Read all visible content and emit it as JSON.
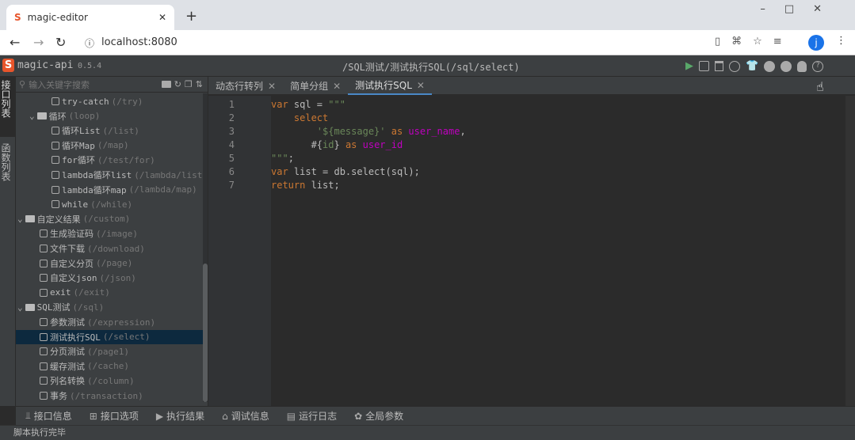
{
  "browser": {
    "tab_title": "magic-editor",
    "url": "localhost:8080",
    "avatar": "j"
  },
  "app": {
    "name": "magic-api",
    "version": "0.5.4",
    "path_title": "/SQL测试/测试执行SQL(/sql/select)"
  },
  "side_tabs": [
    {
      "label": "接口列表"
    },
    {
      "label": "函数列表"
    }
  ],
  "search": {
    "placeholder": "输入关键字搜索"
  },
  "tree": [
    {
      "name": "try-catch",
      "path": "(/try)",
      "type": "api",
      "level": 2
    },
    {
      "name": "循环",
      "path": "(loop)",
      "type": "folder",
      "level": 1
    },
    {
      "name": "循环List",
      "path": "(/list)",
      "type": "api",
      "level": 2
    },
    {
      "name": "循环Map",
      "path": "(/map)",
      "type": "api",
      "level": 2
    },
    {
      "name": "for循环",
      "path": "(/test/for)",
      "type": "api",
      "level": 2
    },
    {
      "name": "lambda循环list",
      "path": "(/lambda/list)",
      "type": "api",
      "level": 2
    },
    {
      "name": "lambda循环map",
      "path": "(/lambda/map)",
      "type": "api",
      "level": 2
    },
    {
      "name": "while",
      "path": "(/while)",
      "type": "api",
      "level": 2
    },
    {
      "name": "自定义结果",
      "path": "(/custom)",
      "type": "folder",
      "level": 0
    },
    {
      "name": "生成验证码",
      "path": "(/image)",
      "type": "api",
      "level": 1
    },
    {
      "name": "文件下载",
      "path": "(/download)",
      "type": "api",
      "level": 1
    },
    {
      "name": "自定义分页",
      "path": "(/page)",
      "type": "api",
      "level": 1
    },
    {
      "name": "自定义json",
      "path": "(/json)",
      "type": "api",
      "level": 1
    },
    {
      "name": "exit",
      "path": "(/exit)",
      "type": "api",
      "level": 1
    },
    {
      "name": "SQL测试",
      "path": "(/sql)",
      "type": "folder",
      "level": 0
    },
    {
      "name": "参数测试",
      "path": "(/expression)",
      "type": "api",
      "level": 1
    },
    {
      "name": "测试执行SQL",
      "path": "(/select)",
      "type": "api",
      "level": 1,
      "selected": true
    },
    {
      "name": "分页测试",
      "path": "(/page1)",
      "type": "api",
      "level": 1
    },
    {
      "name": "缓存测试",
      "path": "(/cache)",
      "type": "api",
      "level": 1
    },
    {
      "name": "列名转换",
      "path": "(/column)",
      "type": "api",
      "level": 1
    },
    {
      "name": "事务",
      "path": "(/transaction)",
      "type": "api",
      "level": 1
    }
  ],
  "editor_tabs": [
    {
      "label": "动态行转列"
    },
    {
      "label": "简单分组"
    },
    {
      "label": "测试执行SQL",
      "active": true
    }
  ],
  "code_lines": [
    [
      [
        "k",
        "var"
      ],
      [
        "t",
        " sql = "
      ],
      [
        "s",
        "\"\"\""
      ]
    ],
    [
      [
        "t",
        "    "
      ],
      [
        "k",
        "select"
      ]
    ],
    [
      [
        "t",
        "        "
      ],
      [
        "s",
        "'${message}'"
      ],
      [
        "t",
        " "
      ],
      [
        "k",
        "as"
      ],
      [
        "t",
        " "
      ],
      [
        "v",
        "user_name"
      ],
      [
        "t",
        ","
      ]
    ],
    [
      [
        "t",
        "       #{"
      ],
      [
        "s",
        "id"
      ],
      [
        "t",
        "} "
      ],
      [
        "k",
        "as"
      ],
      [
        "t",
        " "
      ],
      [
        "v",
        "user_id"
      ]
    ],
    [
      [
        "s",
        "\"\"\""
      ],
      [
        "t",
        ";"
      ]
    ],
    [
      [
        "k",
        "var"
      ],
      [
        "t",
        " list = db.select(sql);"
      ]
    ],
    [
      [
        "k",
        "return"
      ],
      [
        "t",
        " list;"
      ]
    ]
  ],
  "bottom_tabs": [
    {
      "label": "接口信息"
    },
    {
      "label": "接口选项"
    },
    {
      "label": "执行结果"
    },
    {
      "label": "调试信息"
    },
    {
      "label": "运行日志"
    },
    {
      "label": "全局参数"
    }
  ],
  "status": "脚本执行完毕",
  "colors": {
    "keyword": "#cc7832",
    "string": "#6a8759",
    "var": "#c000c0",
    "run": "#59a869"
  }
}
